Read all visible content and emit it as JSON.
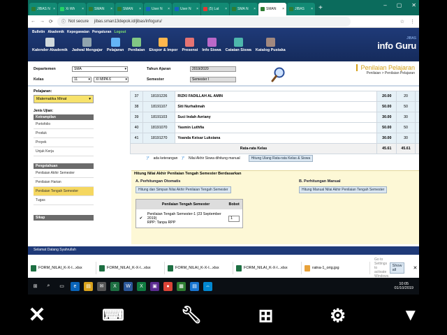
{
  "browser": {
    "tabs": [
      {
        "label": "JIBAS N",
        "color": "#2e7d32",
        "active": false
      },
      {
        "label": "Xi Wh",
        "color": "#25d366",
        "active": false
      },
      {
        "label": "SMAN",
        "color": "#2e7d32",
        "active": false
      },
      {
        "label": "SMAN",
        "color": "#2e7d32",
        "active": false
      },
      {
        "label": "User N",
        "color": "#1565c0",
        "active": false
      },
      {
        "label": "User N",
        "color": "#1565c0",
        "active": false
      },
      {
        "label": "(5) Lat",
        "color": "#e53935",
        "active": false
      },
      {
        "label": "SMA N",
        "color": "#2e7d32",
        "active": false
      },
      {
        "label": "SMAN",
        "color": "#2e7d32",
        "active": true
      },
      {
        "label": "JIBAS",
        "color": "#2e7d32",
        "active": false
      }
    ],
    "not_secure": "Not secure",
    "url": "jibas.sman13depok.id/jibas/infoguru/"
  },
  "app": {
    "topmenu": [
      "Bulletin",
      "Akademik",
      "Kepegawaian",
      "Pengaturan",
      "Logout"
    ],
    "nav": [
      {
        "label": "Kalender Akademik",
        "icon": "calendar-icon",
        "color": "#cfd8dc"
      },
      {
        "label": "Jadwal Mengajar",
        "icon": "schedule-icon",
        "color": "#90a4ae"
      },
      {
        "label": "Pelajaran",
        "icon": "book-icon",
        "color": "#64b5f6"
      },
      {
        "label": "Penilaian",
        "icon": "grade-icon",
        "color": "#81c784"
      },
      {
        "label": "Ekspor & Impor",
        "icon": "export-icon",
        "color": "#ffb74d"
      },
      {
        "label": "Presensi",
        "icon": "attendance-icon",
        "color": "#e57373"
      },
      {
        "label": "Info Siswa",
        "icon": "student-icon",
        "color": "#ba68c8"
      },
      {
        "label": "Catatan Siswa",
        "icon": "notes-icon",
        "color": "#4db6ac"
      },
      {
        "label": "Katalog Pustaka",
        "icon": "library-icon",
        "color": "#a1887f"
      }
    ],
    "brand_small": "JIBAS",
    "brand": "info Guru"
  },
  "filters": {
    "departemen_label": "Departemen",
    "departemen": "SMA",
    "kelas_label": "Kelas",
    "tingkat": "11",
    "kelas": "XI MIPA 6",
    "tahun_label": "Tahun Ajaran",
    "tahun": "2019/2020",
    "semester_label": "Semester",
    "semester": "Semester I",
    "title": "Penilaian Pelajaran",
    "breadcrumb": "Penilaian > Penilaian Pelajaran"
  },
  "left": {
    "pelajaran_label": "Pelajaran:",
    "pelajaran": "Matematika Minat",
    "jenis_label": "Jenis Ujian:",
    "ketrampilan_head": "Ketrampilan",
    "ketrampilan": [
      "Portofolio",
      "Produk",
      "Proyek",
      "Unjuk Kerja"
    ],
    "pengetahuan_head": "Pengetahuan",
    "pengetahuan": [
      "Penilaian Akhir Semester",
      "Penilaian Harian",
      "Penilaian Tengah Semester",
      "Tugas"
    ],
    "sikap_head": "Sikap"
  },
  "table": {
    "rows": [
      {
        "no": "37",
        "nis": "18191226",
        "nama": "RIZKI FADILLAH AL AMIN",
        "n1": "20.00",
        "n2": "20",
        "n3": "20.00"
      },
      {
        "no": "38",
        "nis": "18191107",
        "nama": "Siti Nurhalimah",
        "n1": "50.00",
        "n2": "50",
        "n3": "50.00"
      },
      {
        "no": "39",
        "nis": "18191103",
        "nama": "Suci Indah Avriany",
        "n1": "30.00",
        "n2": "30",
        "n3": "30.00"
      },
      {
        "no": "40",
        "nis": "18191070",
        "nama": "Yasmin Luthfia",
        "n1": "50.00",
        "n2": "50",
        "n3": "50.00"
      },
      {
        "no": "41",
        "nis": "18191270",
        "nama": "Yoanda Keisar Luksiana",
        "n1": "30.00",
        "n2": "30",
        "n3": "30.00"
      }
    ],
    "avg_label": "Rata-rata Kelas",
    "avg": [
      "45.61",
      "45.61",
      "45.61"
    ]
  },
  "legend": {
    "ast1": ")*",
    "ada_keterangan": "ada keterangan",
    "ast2": ")*",
    "nilai_akhir": "Nilai Akhir Siswa dihitung manual",
    "button": "Hitung Ulang Rata-rata Kelas & Siswa"
  },
  "hitung": {
    "title": "Hitung Nilai Akhir Penilaian Tengah Semester Berdasarkan",
    "a_label": "A. Perhitungan Otomatis",
    "a_button": "Hitung dan Simpan Nilai Akhir Penilaian Tengah Semester",
    "b_label": "B. Perhitungan Manual",
    "b_button": "Hitung Manual Nilai Akhir Penilaian Tengah Semester",
    "col1": "Penilaian Tengah Semester",
    "col2": "Bobot",
    "item": "Penilaian Tengah Semester-1 (23 September 2019)",
    "rpp": "RPP: Tanpa RPP",
    "bobot": "1"
  },
  "status": "Selamat Datang Syahrullah",
  "downloads": {
    "items": [
      "FORM_NILAI_K-X-I...xlsx",
      "FORM_NILAI_K-X-I...xlsx",
      "FORM_NILAI_K-X-I...xlsx",
      "FORM_NILAI_K-X-I...xlsx",
      "ratna-1_orig.jpg"
    ],
    "activate": "Go to Settings to activate Windows.",
    "show_all": "Show all"
  },
  "taskbar": {
    "time": "10:05",
    "date": "01/10/2019"
  }
}
